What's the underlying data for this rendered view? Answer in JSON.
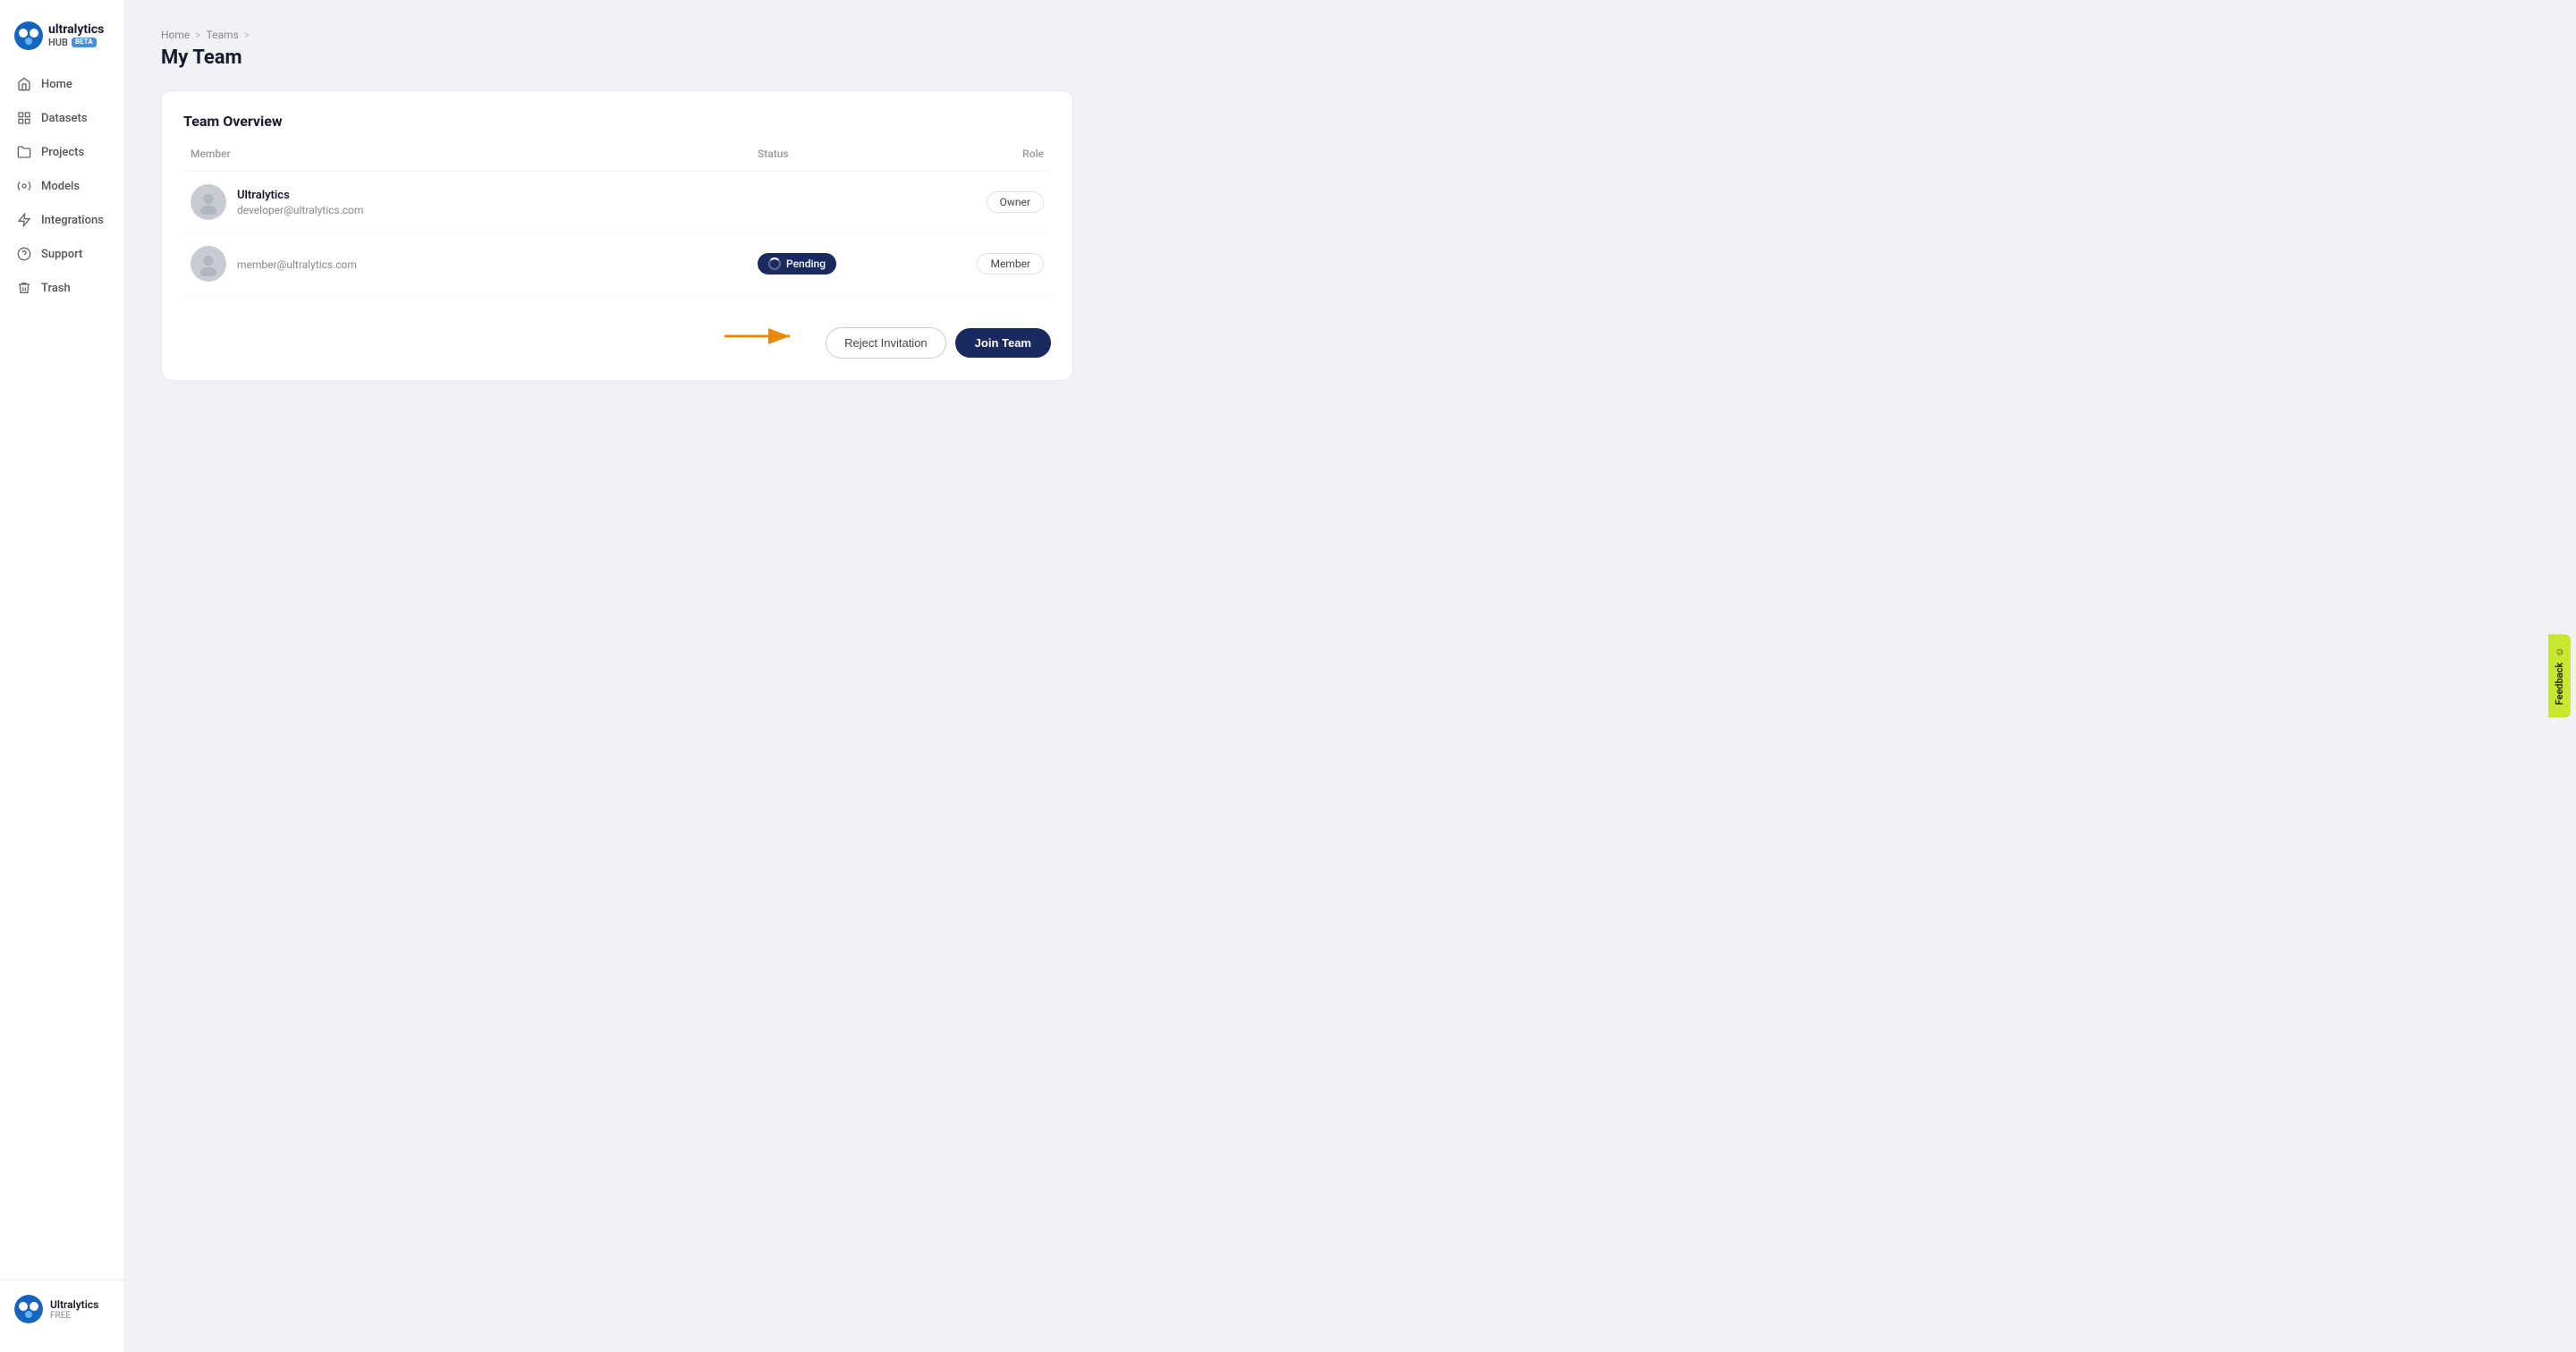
{
  "sidebar": {
    "logo": {
      "name": "ultralytics",
      "hub": "HUB",
      "beta": "BETA"
    },
    "nav_items": [
      {
        "id": "home",
        "label": "Home",
        "icon": "home"
      },
      {
        "id": "datasets",
        "label": "Datasets",
        "icon": "datasets"
      },
      {
        "id": "projects",
        "label": "Projects",
        "icon": "projects"
      },
      {
        "id": "models",
        "label": "Models",
        "icon": "models"
      },
      {
        "id": "integrations",
        "label": "Integrations",
        "icon": "integrations"
      },
      {
        "id": "support",
        "label": "Support",
        "icon": "support"
      },
      {
        "id": "trash",
        "label": "Trash",
        "icon": "trash"
      }
    ],
    "user": {
      "name": "Ultralytics",
      "plan": "FREE"
    }
  },
  "breadcrumb": {
    "items": [
      "Home",
      "Teams"
    ],
    "separators": [
      ">",
      ">"
    ]
  },
  "page_title": "My Team",
  "card": {
    "title": "Team Overview",
    "columns": {
      "member": "Member",
      "status": "Status",
      "role": "Role"
    },
    "members": [
      {
        "name": "Ultralytics",
        "email": "developer@ultralytics.com",
        "status": "",
        "role": "Owner"
      },
      {
        "name": "",
        "email": "member@ultralytics.com",
        "status": "Pending",
        "role": "Member"
      }
    ],
    "buttons": {
      "reject": "Reject Invitation",
      "join": "Join Team"
    }
  },
  "feedback": {
    "label": "Feedback"
  }
}
